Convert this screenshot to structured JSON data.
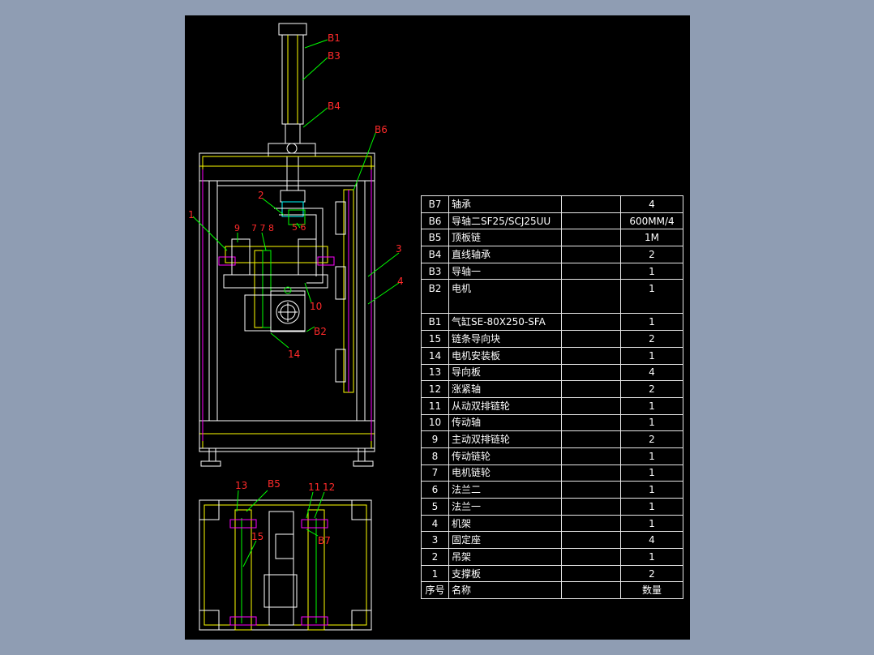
{
  "colors": {
    "background": "#8f9db3",
    "canvas": "#000000",
    "frame": "#ffffff",
    "label": "#ff2a2a",
    "leader": "#00ff00",
    "part": "#ffff00",
    "accent": "#ff00ff",
    "aux": "#00ffff"
  },
  "callouts": {
    "b1": "B1",
    "b3": "B3",
    "b4": "B4",
    "b6": "B6",
    "b2": "B2",
    "b5": "B5",
    "b7": "B7",
    "n1": "1",
    "n2": "2",
    "n3": "3",
    "n4": "4",
    "n9": "9",
    "n78": "7 7 8",
    "n56": "5 6",
    "n10": "10",
    "n14": "14",
    "n13": "13",
    "n15": "15",
    "n11": "11",
    "n12": "12"
  },
  "bom": {
    "rows": [
      {
        "no": "B7",
        "name": "轴承",
        "qty": "4"
      },
      {
        "no": "B6",
        "name": "导轴二SF25/SCJ25UU",
        "qty": "600MM/4"
      },
      {
        "no": "B5",
        "name": "顶板链",
        "qty": "1M"
      },
      {
        "no": "B4",
        "name": "直线轴承",
        "qty": "2"
      },
      {
        "no": "B3",
        "name": "导轴一",
        "qty": "1"
      },
      {
        "no": "B2",
        "name": "电机",
        "qty": "1"
      },
      {
        "no": "B1",
        "name": "气缸SE-80X250-SFA",
        "qty": "1"
      },
      {
        "no": "15",
        "name": "链条导向块",
        "qty": "2"
      },
      {
        "no": "14",
        "name": "电机安装板",
        "qty": "1"
      },
      {
        "no": "13",
        "name": "导向板",
        "qty": "4"
      },
      {
        "no": "12",
        "name": "涨紧轴",
        "qty": "2"
      },
      {
        "no": "11",
        "name": "从动双排链轮",
        "qty": "1"
      },
      {
        "no": "10",
        "name": "传动轴",
        "qty": "1"
      },
      {
        "no": "9",
        "name": "主动双排链轮",
        "qty": "2"
      },
      {
        "no": "8",
        "name": "传动链轮",
        "qty": "1"
      },
      {
        "no": "7",
        "name": "电机链轮",
        "qty": "1"
      },
      {
        "no": "6",
        "name": "法兰二",
        "qty": "1"
      },
      {
        "no": "5",
        "name": "法兰一",
        "qty": "1"
      },
      {
        "no": "4",
        "name": "机架",
        "qty": "1"
      },
      {
        "no": "3",
        "name": "固定座",
        "qty": "4"
      },
      {
        "no": "2",
        "name": "吊架",
        "qty": "1"
      },
      {
        "no": "1",
        "name": "支撑板",
        "qty": "2"
      }
    ],
    "header": {
      "no": "序号",
      "name": "名称",
      "qty": "数量"
    }
  }
}
